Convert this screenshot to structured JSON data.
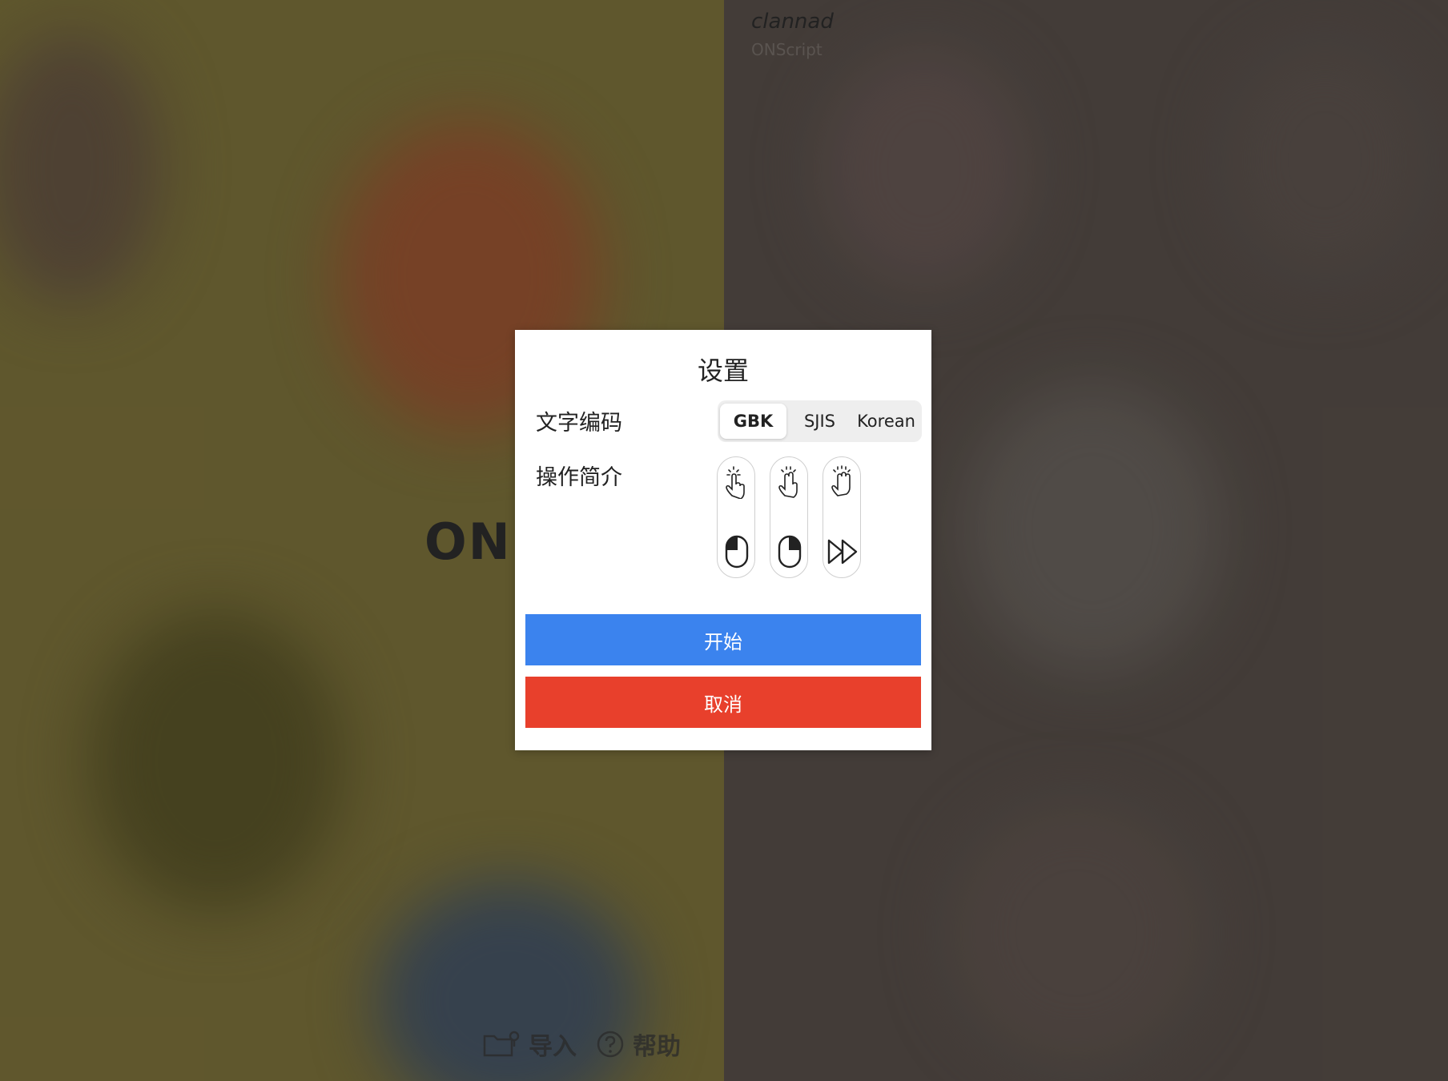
{
  "background": {
    "game_title": "clannad",
    "game_subtitle": "ONScript",
    "logo_partial": "ONS",
    "bottom_bar": {
      "import_label": "导入",
      "help_label": "帮助"
    }
  },
  "dialog": {
    "title": "设置",
    "encoding_label": "文字编码",
    "encoding_options": [
      "GBK",
      "SJIS",
      "Korean"
    ],
    "encoding_selected": "GBK",
    "controls_label": "操作简介",
    "controls": [
      {
        "gesture": "tap-one-finger-icon",
        "action": "mouse-left-click-icon"
      },
      {
        "gesture": "tap-two-finger-icon",
        "action": "mouse-right-click-icon"
      },
      {
        "gesture": "tap-three-finger-icon",
        "action": "fast-forward-icon"
      }
    ],
    "start_label": "开始",
    "cancel_label": "取消"
  },
  "colors": {
    "start": "#3b83ee",
    "cancel": "#e8402c"
  }
}
